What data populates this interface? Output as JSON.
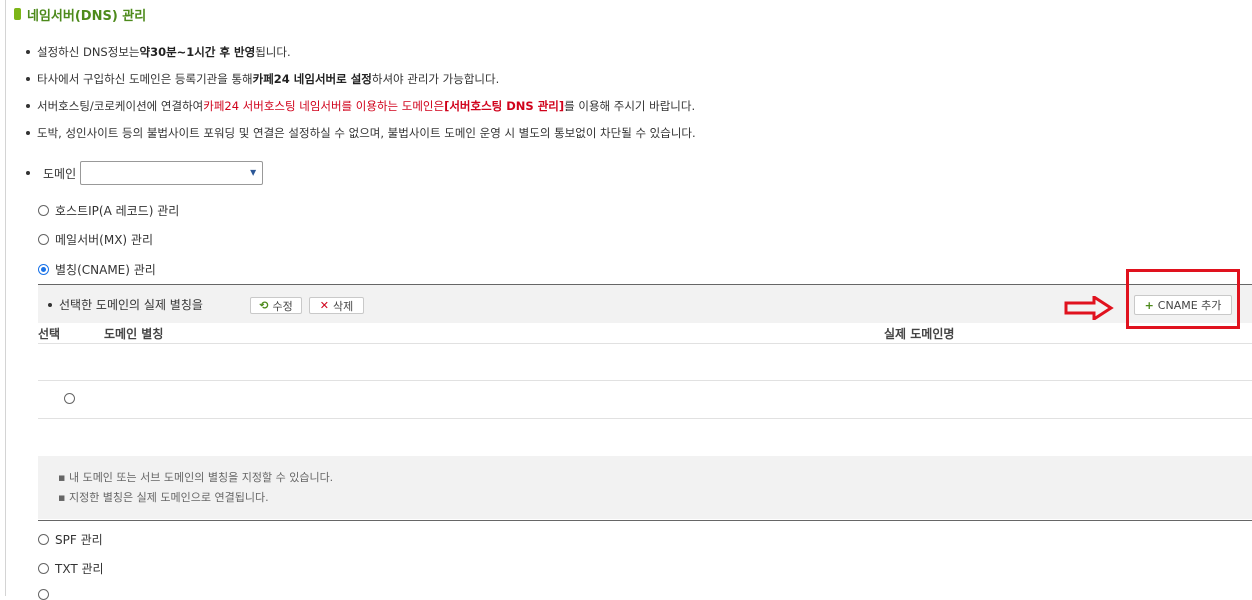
{
  "page": {
    "title": "네임서버(DNS) 관리"
  },
  "notices": [
    {
      "parts": [
        {
          "t": "설정하신 DNS정보는 ",
          "s": ""
        },
        {
          "t": "약30분~1시간 후 반영",
          "s": "b"
        },
        {
          "t": "됩니다.",
          "s": ""
        }
      ]
    },
    {
      "parts": [
        {
          "t": "타사에서 구입하신 도메인은 등록기관을 통해 ",
          "s": ""
        },
        {
          "t": "카페24 네임서버로 설정",
          "s": "b"
        },
        {
          "t": "하셔야 관리가 가능합니다.",
          "s": ""
        }
      ]
    },
    {
      "parts": [
        {
          "t": "서버호스팅/코로케이션에 연결하여 ",
          "s": ""
        },
        {
          "t": "카페24 서버호스팅 네임서버를 이용하는 도메인은",
          "s": "r"
        },
        {
          "t": "[서버호스팅 DNS 관리]",
          "s": "rb"
        },
        {
          "t": "를 이용해 주시기 바랍니다.",
          "s": ""
        }
      ]
    },
    {
      "parts": [
        {
          "t": "도박, 성인사이트 등의 불법사이트 포워딩 및 연결은 설정하실 수 없으며, 불법사이트 도메인 운영 시 별도의 통보없이 차단될 수 있습니다.",
          "s": ""
        }
      ]
    }
  ],
  "domain": {
    "label": "도메인",
    "selected": ""
  },
  "record_types": [
    {
      "label": "호스트IP(A 레코드) 관리",
      "checked": false
    },
    {
      "label": "메일서버(MX) 관리",
      "checked": false
    },
    {
      "label": "별칭(CNAME) 관리",
      "checked": true
    },
    {
      "label": "SPF 관리",
      "checked": false
    },
    {
      "label": "TXT 관리",
      "checked": false
    }
  ],
  "cname": {
    "head_label": "선택한 도메인의 실제 별칭을",
    "edit_label": "수정",
    "delete_label": "삭제",
    "add_label": "CNAME 추가",
    "columns": {
      "select": "선택",
      "alias": "도메인 별칭",
      "real": "실제 도메인명"
    },
    "help": [
      "내 도메인 또는 서브 도메인의 별칭을 지정할 수 있습니다.",
      "지정한 별칭은 실제 도메인으로 연결됩니다."
    ]
  },
  "annotation_color": "#e0121e",
  "accent_green": "#4d8a1b"
}
